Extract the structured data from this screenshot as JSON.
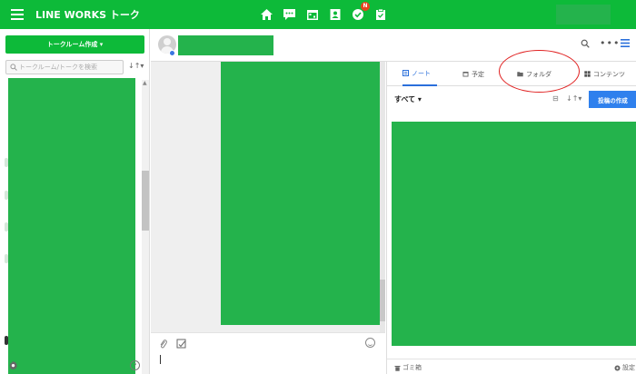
{
  "app": {
    "title": "LINE WORKS トーク"
  },
  "topnav": {
    "badge": "N"
  },
  "left": {
    "create_button": "トークルーム作成 ▾",
    "search_placeholder": "トークルーム/トークを検索",
    "sort_label": "↓↑▾"
  },
  "side": {
    "tabs": [
      {
        "label": "ノート",
        "active": true
      },
      {
        "label": "予定",
        "active": false
      },
      {
        "label": "フォルダ",
        "active": false
      },
      {
        "label": "コンテンツ",
        "active": false
      }
    ],
    "filter_label": "すべて ▾",
    "filter_sort": "↓↑▾",
    "filter_a": "⊟",
    "post_button": "投稿の作成",
    "trash_label": "ゴミ箱",
    "settings_label": "設定"
  },
  "colors": {
    "brand": "#0dba39",
    "accent": "#2f80ed",
    "annotation": "#e02020"
  }
}
